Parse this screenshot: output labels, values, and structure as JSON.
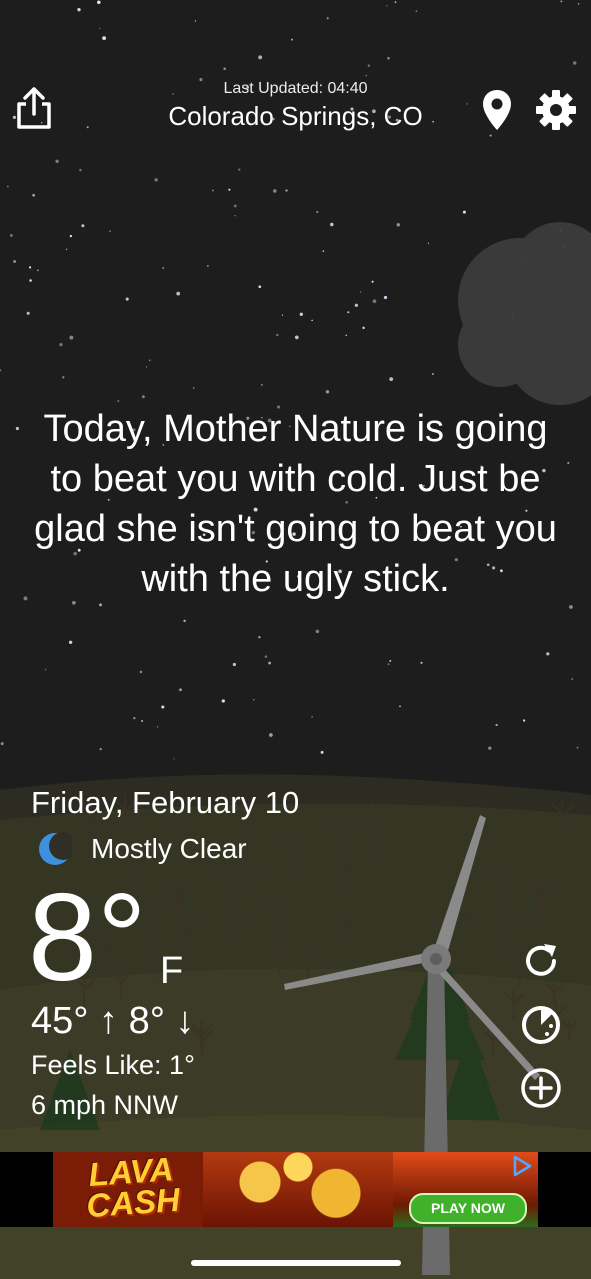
{
  "header": {
    "last_updated": "Last Updated: 04:40",
    "location": "Colorado Springs, CO",
    "share_icon": "share-icon",
    "location_icon": "location-pin-icon",
    "settings_icon": "gear-icon"
  },
  "quote": "Today, Mother Nature is going to beat you with cold. Just be glad she isn't going to beat you with the ugly stick.",
  "weather": {
    "date": "Friday, February 10",
    "condition": "Mostly Clear",
    "condition_icon": "crescent-moon-icon",
    "temperature": "8°",
    "unit": "F",
    "hi_lo": "45° ↑ 8° ↓",
    "feels_like": "Feels Like: 1°",
    "wind": "6 mph NNW"
  },
  "actions": {
    "refresh_icon": "refresh-icon",
    "radar_icon": "radar-icon",
    "add_icon": "add-circle-icon"
  },
  "ad": {
    "title": "LAVA CASH",
    "cta": "PLAY NOW",
    "adchoices_icon": "adchoices-icon"
  },
  "colors": {
    "sky": "#1d1d1d",
    "hill": "#3a3a26",
    "moon": "#3f8fdf",
    "text": "#ffffff"
  }
}
